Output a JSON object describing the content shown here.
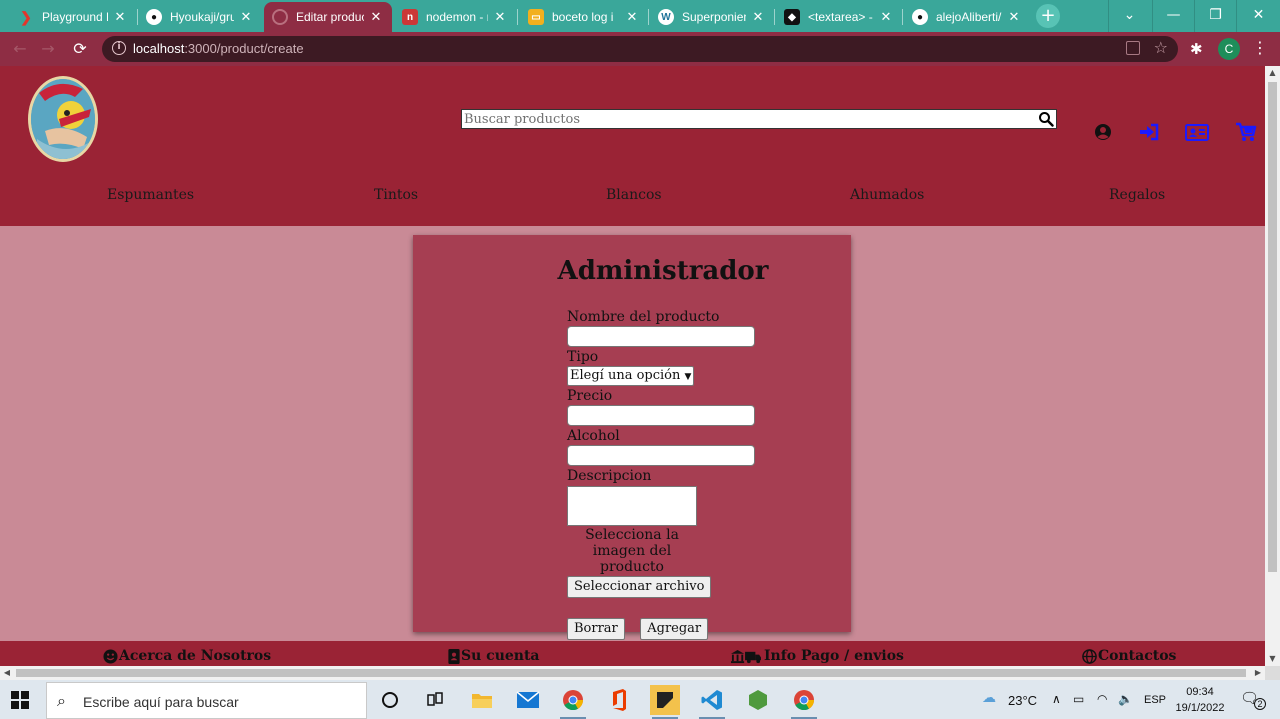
{
  "browser": {
    "tabs": [
      {
        "title": "Playground D",
        "active": false
      },
      {
        "title": "Hyoukaji/gru",
        "active": false
      },
      {
        "title": "Editar produc",
        "active": true
      },
      {
        "title": "nodemon - n",
        "active": false
      },
      {
        "title": "boceto log i",
        "active": false
      },
      {
        "title": "Superponien",
        "active": false
      },
      {
        "title": "<textarea> -",
        "active": false
      },
      {
        "title": "alejoAliberti/",
        "active": false
      }
    ],
    "tab_close_glyph": "✕",
    "new_tab_glyph": "+",
    "url_host": "localhost",
    "url_path": ":3000/product/create",
    "profile_initial": "C",
    "window_controls": {
      "tabsearch": "⌄",
      "minimize": "—",
      "restore": "❐",
      "close": "✕"
    }
  },
  "site": {
    "search_placeholder": "Buscar productos",
    "header_icons": [
      "user-circle-icon",
      "sign-in-icon",
      "id-card-icon",
      "cart-icon"
    ],
    "nav": [
      "Espumantes",
      "Tintos",
      "Blancos",
      "Ahumados",
      "Regalos"
    ],
    "colors": {
      "header": "#9a2335",
      "page_bg": "#c98a96",
      "card": "#a63e52",
      "icon_blue": "#1a1aff"
    }
  },
  "form": {
    "title": "Administrador",
    "name_label": "Nombre del producto",
    "type_label": "Tipo",
    "type_selected": "Elegí una opción",
    "price_label": "Precio",
    "alcohol_label": "Alcohol",
    "description_label": "Descripcion",
    "image_label": "Selecciona la imagen del producto",
    "file_button": "Seleccionar archivo",
    "reset_button": "Borrar",
    "submit_button": "Agregar"
  },
  "footer": [
    {
      "label": "Acerca de Nosotros",
      "icon": "smile-icon"
    },
    {
      "label": "Su cuenta",
      "icon": "address-book-icon"
    },
    {
      "label": "Info Pago / envios",
      "icon": "bank-truck-icon"
    },
    {
      "label": "Contactos",
      "icon": "globe-icon"
    }
  ],
  "taskbar": {
    "search_placeholder": "Escribe aquí para buscar",
    "apps": [
      "cortana-icon",
      "task-view-icon",
      "file-explorer-icon",
      "mail-icon",
      "chrome-icon",
      "office-icon",
      "sticky-notes-icon",
      "vscode-icon",
      "nodejs-icon",
      "chrome-icon"
    ],
    "weather": "23°C",
    "language": "ESP",
    "time": "09:34",
    "date": "19/1/2022",
    "notifications": "2"
  }
}
